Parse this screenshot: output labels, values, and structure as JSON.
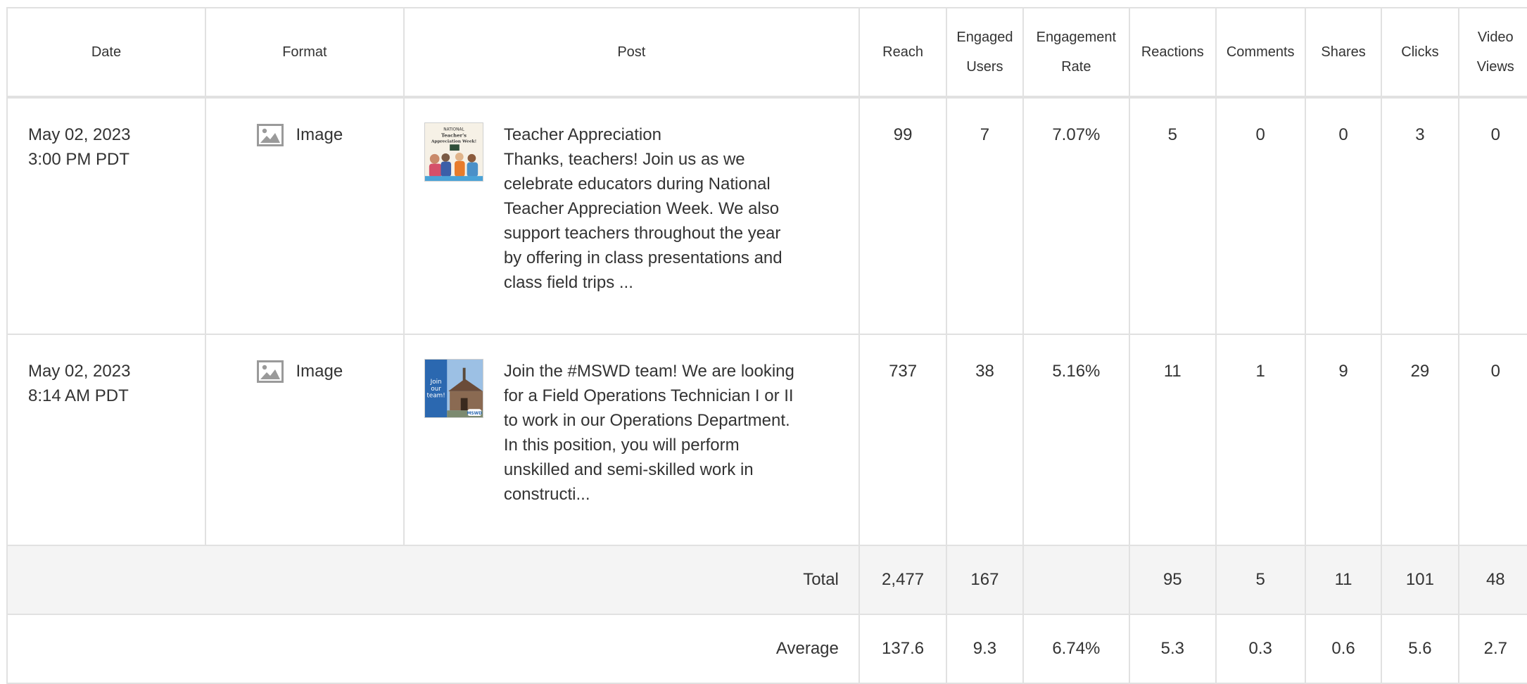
{
  "columns": {
    "date": "Date",
    "format": "Format",
    "post": "Post",
    "reach": "Reach",
    "engaged_users_1": "Engaged",
    "engaged_users_2": "Users",
    "engagement_rate_1": "Engagement",
    "engagement_rate_2": "Rate",
    "reactions": "Reactions",
    "comments": "Comments",
    "shares": "Shares",
    "clicks": "Clicks",
    "video_views_1": "Video",
    "video_views_2": "Views"
  },
  "rows": [
    {
      "date_line1": "May 02, 2023",
      "date_line2": "3:00 PM PDT",
      "format": "Image",
      "format_icon": "image-icon",
      "post_title": "Teacher Appreciation",
      "post_body": "Thanks, teachers! Join us as we celebrate educators during National Teacher Appreciation Week. We also support teachers throughout the year by offering in class presentations and class field trips ...",
      "thumb_text_1": "NATIONAL",
      "thumb_text_2": "Teacher's",
      "thumb_text_3": "Appreciation Week!",
      "reach": "99",
      "engaged_users": "7",
      "engagement_rate": "7.07%",
      "reactions": "5",
      "comments": "0",
      "shares": "0",
      "clicks": "3",
      "video_views": "0"
    },
    {
      "date_line1": "May 02, 2023",
      "date_line2": "8:14 AM PDT",
      "format": "Image",
      "format_icon": "image-icon",
      "post_title": "",
      "post_body": "Join the #MSWD team! We are looking for a Field Operations Technician I or II to work in our Operations Department. In this position, you will perform unskilled and semi-skilled work in constructi...",
      "thumb_text_1": "Join",
      "thumb_text_2": "our",
      "thumb_text_3": "team!",
      "thumb_logo": "MSWD",
      "reach": "737",
      "engaged_users": "38",
      "engagement_rate": "5.16%",
      "reactions": "11",
      "comments": "1",
      "shares": "9",
      "clicks": "29",
      "video_views": "0"
    }
  ],
  "total": {
    "label": "Total",
    "reach": "2,477",
    "engaged_users": "167",
    "engagement_rate": "",
    "reactions": "95",
    "comments": "5",
    "shares": "11",
    "clicks": "101",
    "video_views": "48"
  },
  "average": {
    "label": "Average",
    "reach": "137.6",
    "engaged_users": "9.3",
    "engagement_rate": "6.74%",
    "reactions": "5.3",
    "comments": "0.3",
    "shares": "0.6",
    "clicks": "5.6",
    "video_views": "2.7"
  },
  "colors": {
    "border": "#e1e1e1",
    "total_bg": "#f4f4f4",
    "text": "#333333",
    "icon_gray": "#9a9a9a"
  }
}
